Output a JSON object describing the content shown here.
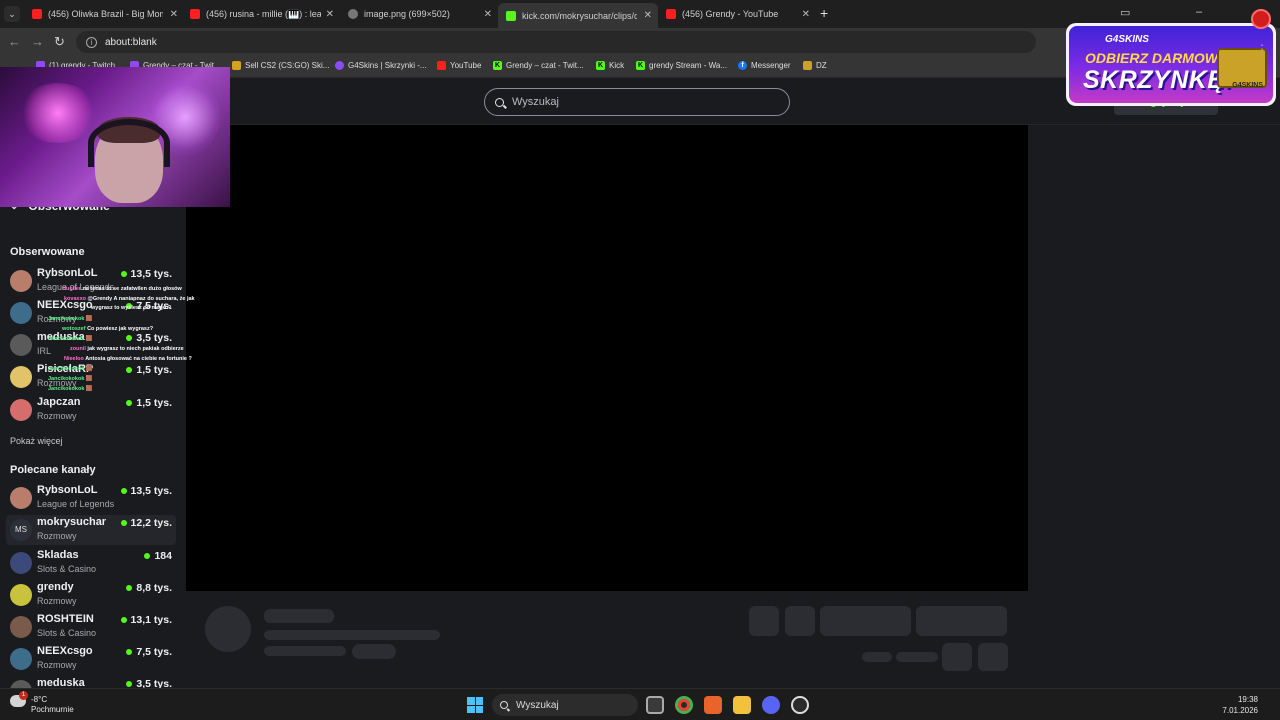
{
  "browser": {
    "tabs": [
      {
        "label": "(456) Oliwka Brazil - Big Momm",
        "icon": "youtube-icon"
      },
      {
        "label": "(456) rusina - millie (🎹) : learnin",
        "icon": "youtube-icon"
      },
      {
        "label": "image.png (699×502)",
        "icon": "image-icon"
      },
      {
        "label": "kick.com/mokrysuchar/clips/clip",
        "icon": "kick-icon"
      },
      {
        "label": "(456) Grendy - YouTube",
        "icon": "youtube-icon"
      }
    ],
    "new_tab": "+",
    "close_glyph": "✕",
    "address": "about:blank",
    "bookmarks": [
      "(1) grendy - Twitch",
      "Grendy – czat - Twit...",
      "Sell CS2 (CS:GO) Ski...",
      "G4Skins | Skrzynki -...",
      "YouTube",
      "Grendy – czat - Twit...",
      "Kick",
      "grendy Stream - Wa...",
      "Messenger",
      "DZ"
    ]
  },
  "site": {
    "search_placeholder": "Wyszukaj",
    "login_label": "Zaloguj/Rejestr",
    "sidebar": {
      "followed_header": "Obserwowane",
      "followed_title": "Obserwowane",
      "followed": [
        {
          "name": "RybsonLoL",
          "category": "League of Legends",
          "viewers": "13,5 tys."
        },
        {
          "name": "NEEXcsgo",
          "category": "Rozmowy",
          "viewers": "7,5 tys."
        },
        {
          "name": "meduska",
          "category": "IRL",
          "viewers": "3,5 tys."
        },
        {
          "name": "PisicelaRP",
          "category": "Rozmowy",
          "viewers": "1,5 tys."
        },
        {
          "name": "Japczan",
          "category": "Rozmowy",
          "viewers": "1,5 tys."
        }
      ],
      "show_more": "Pokaż więcej",
      "recommended_title": "Polecane kanały",
      "recommended": [
        {
          "name": "RybsonLoL",
          "category": "League of Legends",
          "viewers": "13,5 tys."
        },
        {
          "name": "mokrysuchar",
          "category": "Rozmowy",
          "viewers": "12,2 tys.",
          "initials": "MS"
        },
        {
          "name": "Skladas",
          "category": "Slots & Casino",
          "viewers": "184"
        },
        {
          "name": "grendy",
          "category": "Rozmowy",
          "viewers": "8,8 tys."
        },
        {
          "name": "ROSHTEIN",
          "category": "Slots & Casino",
          "viewers": "13,1 tys."
        },
        {
          "name": "NEEXcsgo",
          "category": "Rozmowy",
          "viewers": "7,5 tys."
        },
        {
          "name": "meduska",
          "category": "",
          "viewers": "3,5 tys."
        }
      ]
    }
  },
  "overlay": {
    "chat": [
      {
        "user": "Hugiler",
        "msg": "na tenas to se zafatwilen dużo głosów"
      },
      {
        "user": "kovaxxo",
        "msg": "@Grendy A naniapnaz do suchara, że jak"
      },
      {
        "user": "",
        "msg": "wygrasz to wyślesz do niego ?"
      },
      {
        "user": "Jancikokokok",
        "msg": "🟫"
      },
      {
        "user": "wotoszef",
        "msg": "Co powiesz jak wygrasz?"
      },
      {
        "user": "Jancikokokok",
        "msg": "🟫"
      },
      {
        "user": "zounil",
        "msg": "jak wygrasz to niech pakiak odbierze"
      },
      {
        "user": "Nieeloo",
        "msg": "Antosia głosować na ciebie na fortunie ?"
      },
      {
        "user": "Jancikokokok",
        "msg": "🟫"
      },
      {
        "user": "Jancikokokok",
        "msg": "🟫"
      },
      {
        "user": "Jancikokokok",
        "msg": "🟫"
      }
    ],
    "promo": {
      "brand": "G4SKINS",
      "line1": "ODBIERZ DARMOWĄ",
      "line2": "SKRZYNKĘ!",
      "chest_label": "G4SKINS"
    }
  },
  "taskbar": {
    "temperature": "-8°C",
    "weather": "Pochmurnie",
    "weather_badge": "1",
    "search_label": "Wyszukaj",
    "time": "19:38",
    "date": "7.01.2026"
  },
  "colors": {
    "accent": "#53fc18",
    "page_bg": "#191b1f",
    "skeleton": "#2b2d32"
  }
}
